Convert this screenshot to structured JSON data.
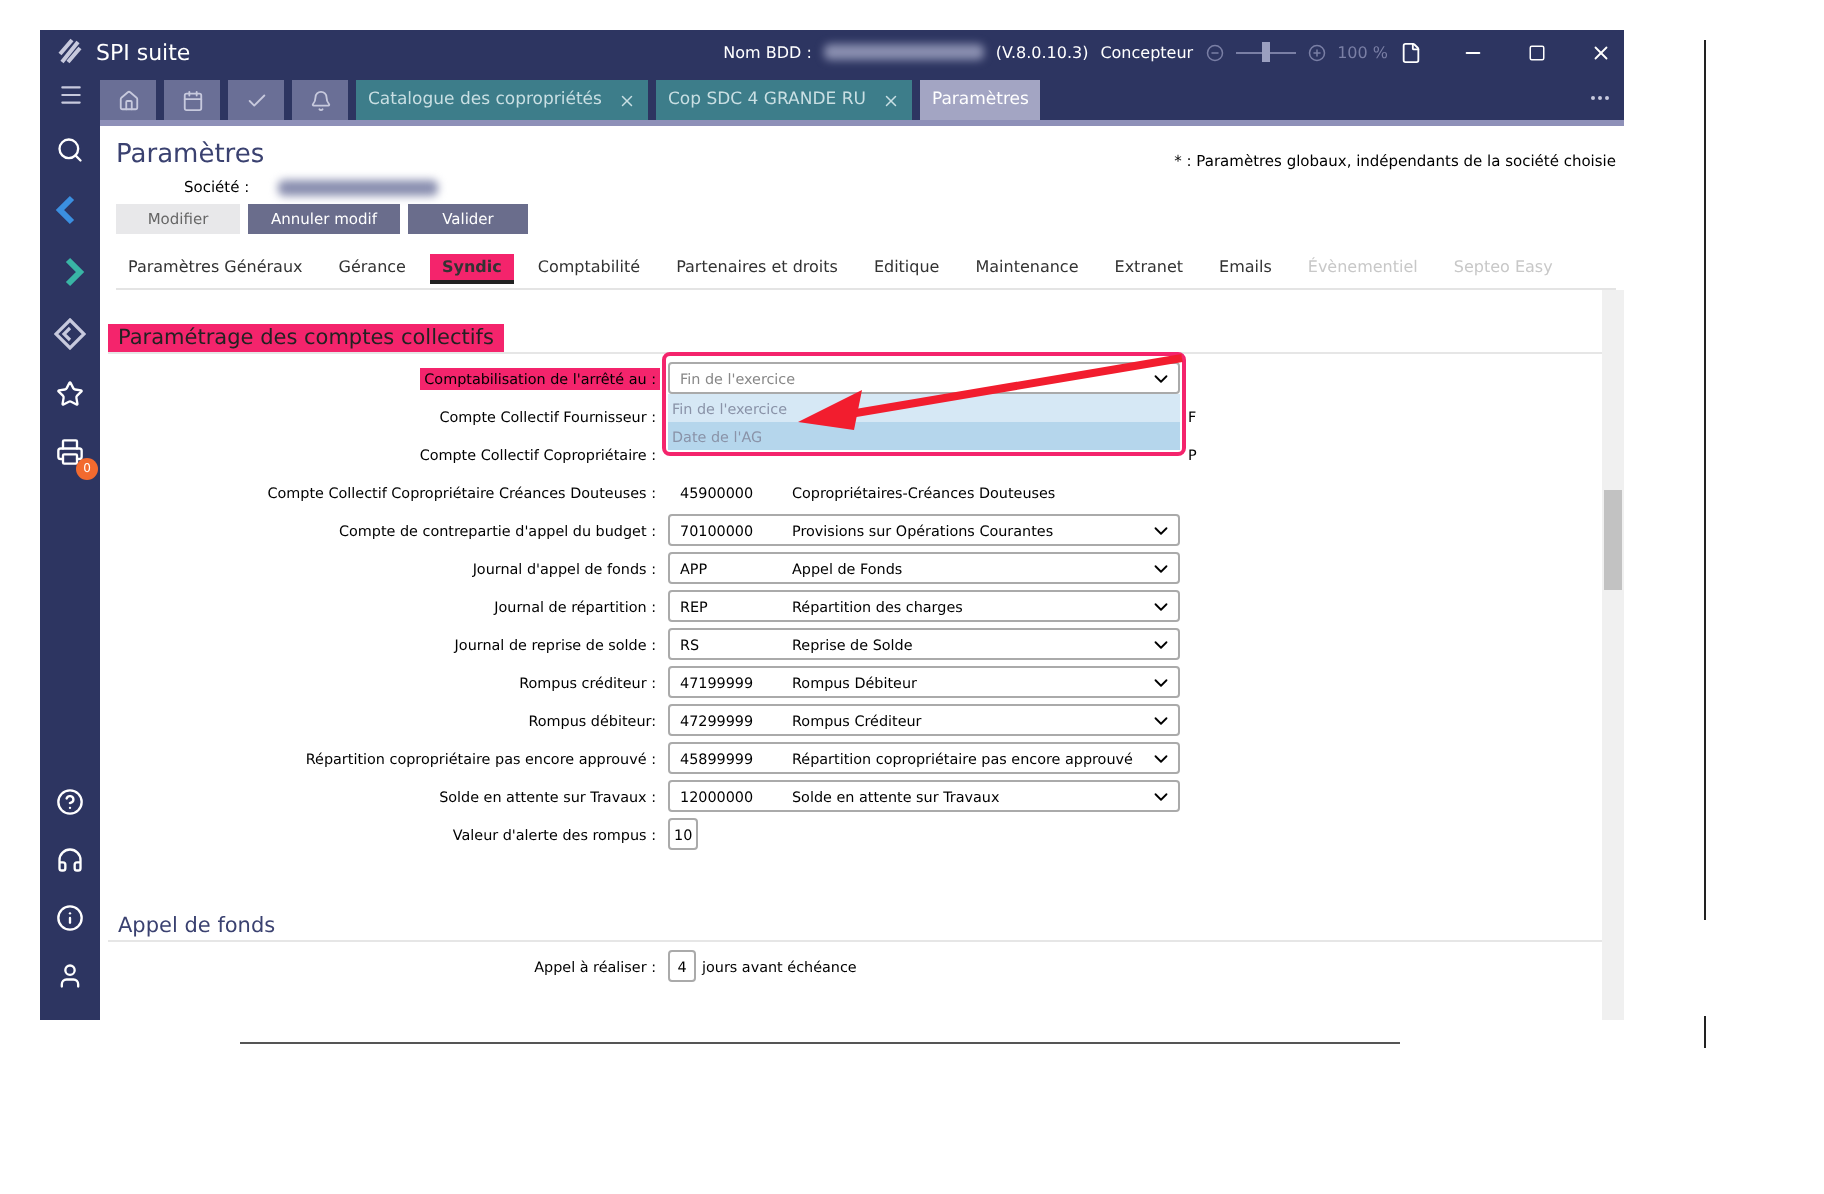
{
  "window": {
    "title": "SPI suite",
    "db_label": "Nom BDD :",
    "version": "(V.8.0.10.3)",
    "role": "Concepteur",
    "zoom": {
      "level": 0.5,
      "reading": "100 %"
    }
  },
  "nav_tabs": [
    {
      "kind": "home",
      "selected": false
    },
    {
      "kind": "calendar",
      "selected": false
    },
    {
      "kind": "check",
      "selected": false
    },
    {
      "kind": "bell",
      "selected": false
    }
  ],
  "doc_tabs": [
    {
      "label": "Catalogue des copropriétés",
      "closable": true,
      "selected": false
    },
    {
      "label": "Cop SDC 4 GRANDE RU",
      "closable": true,
      "selected": false
    },
    {
      "label": "Paramètres",
      "closable": false,
      "selected": true
    }
  ],
  "sidebar": {
    "top": [
      {
        "kind": "search"
      },
      {
        "kind": "back"
      },
      {
        "kind": "forward"
      },
      {
        "kind": "diamond"
      },
      {
        "kind": "star"
      },
      {
        "kind": "printer",
        "badge": "0"
      }
    ],
    "bottom": [
      {
        "kind": "help"
      },
      {
        "kind": "headset"
      },
      {
        "kind": "info"
      },
      {
        "kind": "user"
      }
    ]
  },
  "page": {
    "title": "Paramètres",
    "note": "* : Paramètres globaux, indépendants de la société choisie",
    "company_label": "Société :",
    "buttons": [
      {
        "label": "Modifier",
        "disabled": true
      },
      {
        "label": "Annuler modif",
        "disabled": false
      },
      {
        "label": "Valider",
        "disabled": false
      }
    ]
  },
  "section_tabs": [
    {
      "label": "Paramètres Généraux",
      "selected": false,
      "disabled": false
    },
    {
      "label": "Gérance",
      "selected": false,
      "disabled": false
    },
    {
      "label": "Syndic",
      "selected": true,
      "disabled": false
    },
    {
      "label": "Comptabilité",
      "selected": false,
      "disabled": false
    },
    {
      "label": "Partenaires et droits",
      "selected": false,
      "disabled": false
    },
    {
      "label": "Editique",
      "selected": false,
      "disabled": false
    },
    {
      "label": "Maintenance",
      "selected": false,
      "disabled": false
    },
    {
      "label": "Extranet",
      "selected": false,
      "disabled": false
    },
    {
      "label": "Emails",
      "selected": false,
      "disabled": false
    },
    {
      "label": "Évènementiel",
      "selected": false,
      "disabled": true
    },
    {
      "label": "Septeo Easy",
      "selected": false,
      "disabled": true
    }
  ],
  "sections": [
    {
      "title": "Paramétrage des comptes collectifs",
      "highlighted": true,
      "rows": [
        {
          "kind": "dropdown",
          "label": "Comptabilisation de l'arrêté au :",
          "highlighted": true,
          "value": "Fin de l'exercice",
          "options": [
            {
              "label": "Fin de l'exercice",
              "hovered": false
            },
            {
              "label": "Date de l'AG",
              "hovered": true
            }
          ]
        },
        {
          "kind": "covered",
          "label": "Compte Collectif Fournisseur :",
          "tail": "F"
        },
        {
          "kind": "covered",
          "label": "Compte Collectif Copropriétaire :",
          "tail": "P"
        },
        {
          "kind": "static",
          "label": "Compte Collectif Copropriétaire Créances Douteuses :",
          "code": "45900000",
          "name": "Copropriétaires-Créances Douteuses"
        },
        {
          "kind": "select",
          "label": "Compte de contrepartie d'appel du budget :",
          "code": "70100000",
          "name": "Provisions sur Opérations Courantes"
        },
        {
          "kind": "select",
          "label": "Journal d'appel de fonds :",
          "code": "APP",
          "name": "Appel de Fonds"
        },
        {
          "kind": "select",
          "label": "Journal de répartition :",
          "code": "REP",
          "name": "Répartition des charges"
        },
        {
          "kind": "select",
          "label": "Journal de reprise de solde :",
          "code": "RS",
          "name": "Reprise de Solde"
        },
        {
          "kind": "select",
          "label": "Rompus créditeur :",
          "code": "47199999",
          "name": "Rompus Débiteur"
        },
        {
          "kind": "select",
          "label": "Rompus débiteur:",
          "code": "47299999",
          "name": "Rompus Créditeur"
        },
        {
          "kind": "select",
          "label": "Répartition copropriétaire pas encore approuvé :",
          "code": "45899999",
          "name": "Répartition copropriétaire pas encore approuvé"
        },
        {
          "kind": "select",
          "label": "Solde en attente sur Travaux :",
          "code": "12000000",
          "name": "Solde en attente sur Travaux"
        },
        {
          "kind": "number",
          "label": "Valeur d'alerte des rompus :",
          "value": "10"
        }
      ]
    },
    {
      "title": "Appel de fonds",
      "highlighted": false,
      "rows": [
        {
          "kind": "number",
          "label": "Appel à réaliser :",
          "value": "4",
          "suffix": "jours avant échéance"
        }
      ]
    }
  ]
}
